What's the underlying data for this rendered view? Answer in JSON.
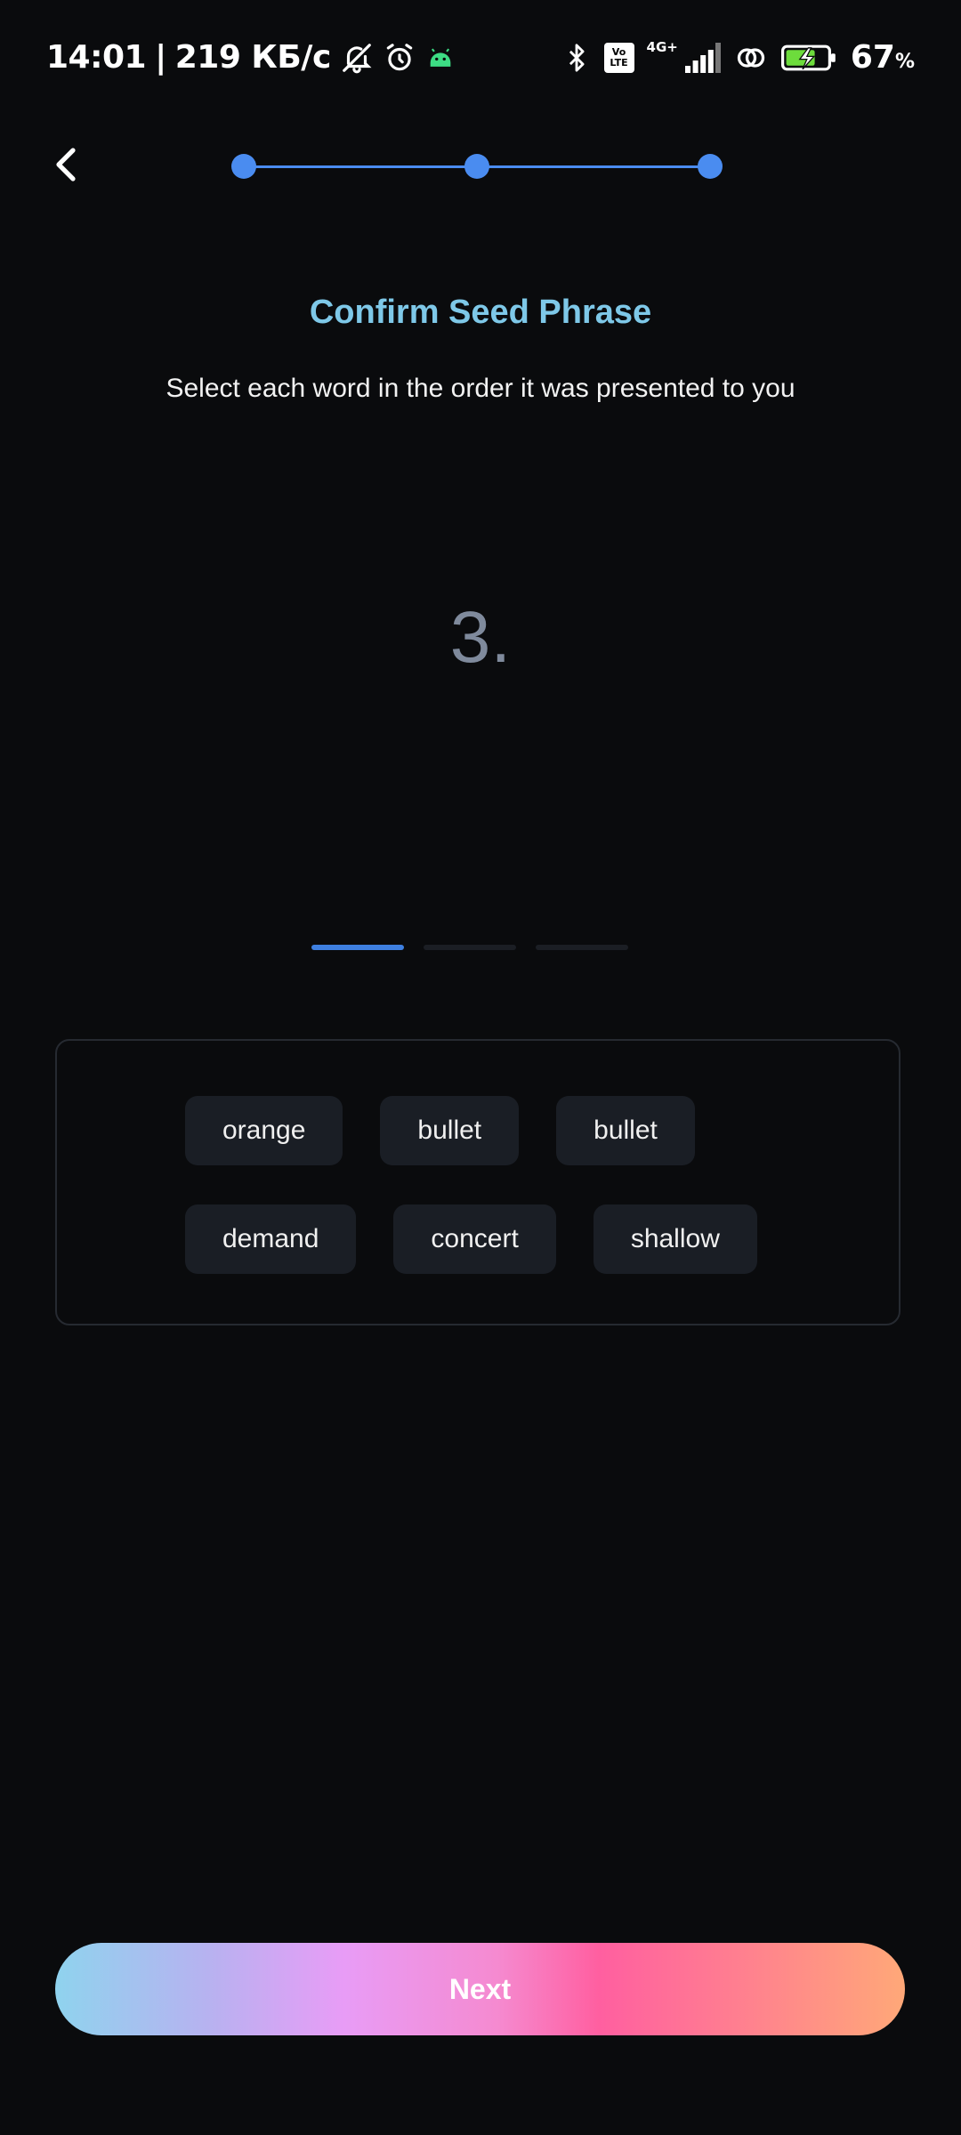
{
  "status_bar": {
    "time": "14:01",
    "separator": "|",
    "speed": "219 КБ/с",
    "network": "4G+",
    "volte_top": "Vo",
    "volte_bottom": "LTE",
    "battery": "67",
    "battery_unit": "%",
    "icons": [
      "bell-muted-icon",
      "alarm-icon",
      "android-icon",
      "bluetooth-icon",
      "volte-icon",
      "signal-icon",
      "link-icon",
      "battery-charging-icon"
    ]
  },
  "header": {
    "back_icon": "chevron-left-icon",
    "steps_total": 3,
    "steps_completed": 3
  },
  "main": {
    "title": "Confirm Seed Phrase",
    "subtitle": "Select each word in the order it was presented to you",
    "word_index": "3.",
    "segments_total": 3,
    "segment_active": 1
  },
  "word_options": {
    "row1": [
      "orange",
      "bullet",
      "bullet"
    ],
    "row2": [
      "demand",
      "concert",
      "shallow"
    ]
  },
  "footer": {
    "next_label": "Next"
  },
  "colors": {
    "background": "#0a0b0d",
    "accent_blue": "#4a8cf0",
    "title_color": "#7ec8e8",
    "chip_bg": "#1a1e25"
  }
}
